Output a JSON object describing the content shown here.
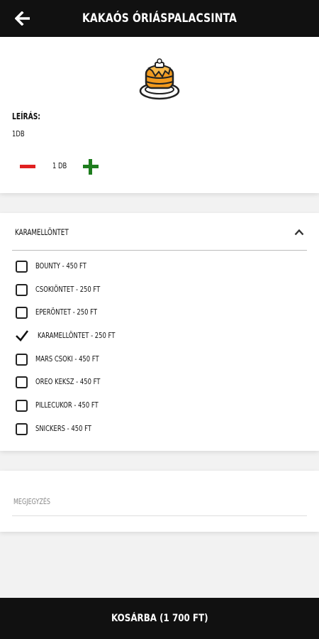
{
  "header": {
    "title": "KAKAÓS ÓRIÁSPALACSINTA",
    "back_icon": "arrow-left-icon"
  },
  "product": {
    "image_icon": "pancake-icon",
    "description_label": "LEÍRÁS:",
    "description_value": "1DB",
    "quantity": "1 DB",
    "colors": {
      "minus": "#e02020",
      "plus": "#1e7d1e"
    }
  },
  "options": {
    "title": "KARAMELLÖNTET",
    "expanded": true,
    "items": [
      {
        "label": "BOUNTY - 450 FT",
        "checked": false
      },
      {
        "label": "CSOKIÖNTET - 250 FT",
        "checked": false
      },
      {
        "label": "EPERÖNTET - 250 FT",
        "checked": false
      },
      {
        "label": "KARAMELLÖNTET - 250 FT",
        "checked": true
      },
      {
        "label": "MARS CSOKI - 450 FT",
        "checked": false
      },
      {
        "label": "OREO KEKSZ - 450 FT",
        "checked": false
      },
      {
        "label": "PILLECUKOR - 450 FT",
        "checked": false
      },
      {
        "label": "SNICKERS - 450 FT",
        "checked": false
      }
    ]
  },
  "note": {
    "placeholder": "MEGJEGYZÉS"
  },
  "footer": {
    "cart_label": "KOSÁRBA (1 700 FT)"
  }
}
